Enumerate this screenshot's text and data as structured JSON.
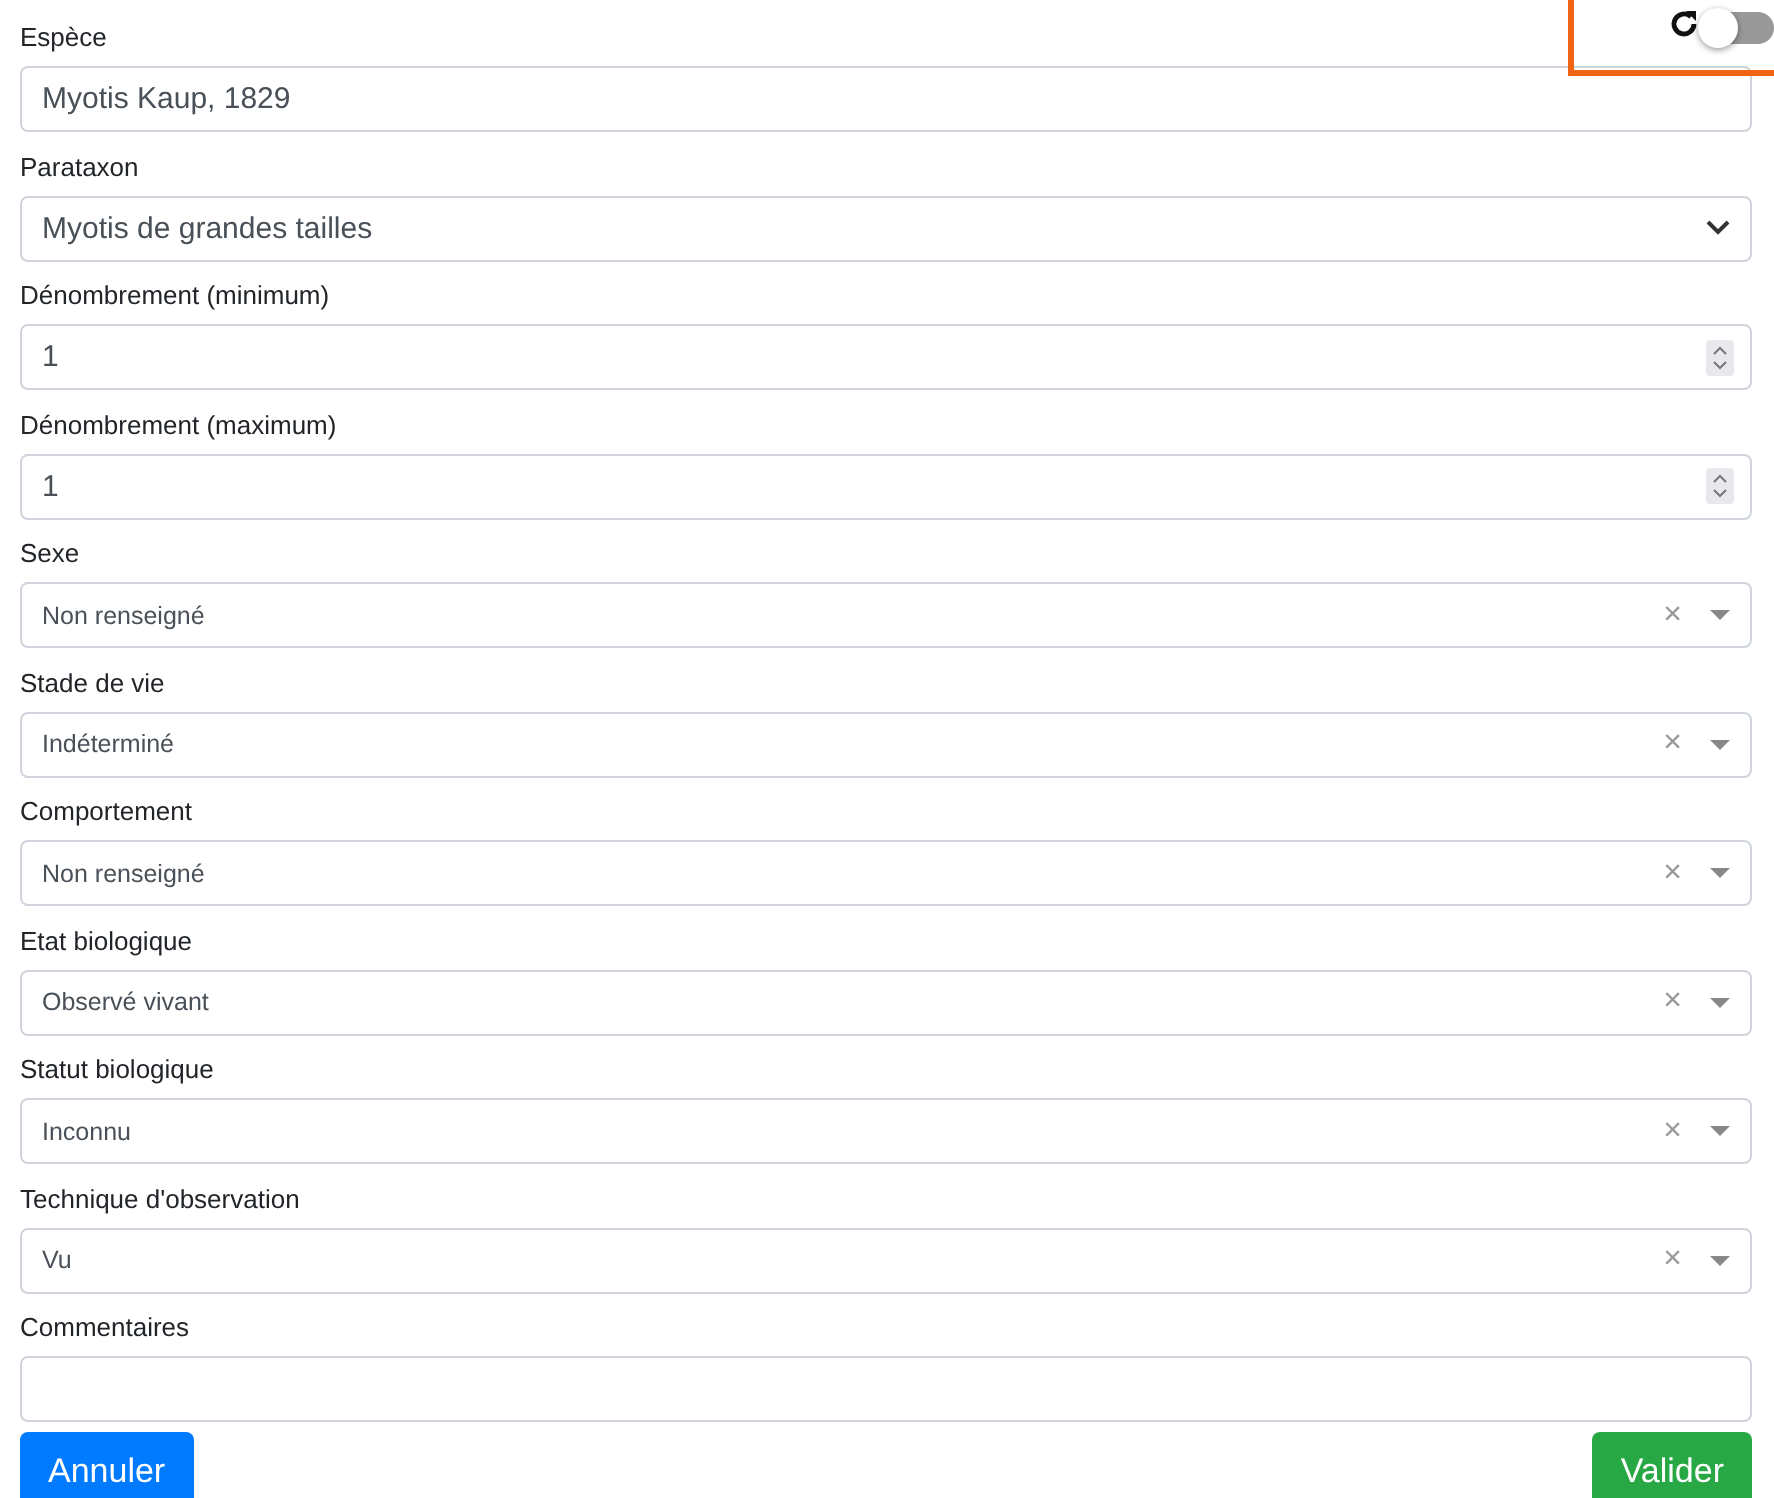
{
  "header_toggle": {
    "on": false
  },
  "fields": [
    {
      "kind": "text",
      "label": "Espèce",
      "value": "Myotis Kaup, 1829"
    },
    {
      "kind": "select",
      "label": "Parataxon",
      "value": "Myotis de grandes tailles"
    },
    {
      "kind": "number",
      "label": "Dénombrement (minimum)",
      "value": "1"
    },
    {
      "kind": "number",
      "label": "Dénombrement (maximum)",
      "value": "1"
    },
    {
      "kind": "combo",
      "label": "Sexe",
      "value": "Non renseigné",
      "clear": "×"
    },
    {
      "kind": "combo",
      "label": "Stade de vie",
      "value": "Indéterminé",
      "clear": "×"
    },
    {
      "kind": "combo",
      "label": "Comportement",
      "value": "Non renseigné",
      "clear": "×"
    },
    {
      "kind": "combo",
      "label": "Etat biologique",
      "value": "Observé vivant",
      "clear": "×"
    },
    {
      "kind": "combo",
      "label": "Statut biologique",
      "value": "Inconnu",
      "clear": "×"
    },
    {
      "kind": "combo",
      "label": "Technique d'observation",
      "value": "Vu",
      "clear": "×"
    },
    {
      "kind": "text",
      "label": "Commentaires"
    }
  ],
  "buttons": [
    {
      "kind": "cancel",
      "label": "Annuler"
    },
    {
      "kind": "submit",
      "label": "Valider"
    }
  ]
}
